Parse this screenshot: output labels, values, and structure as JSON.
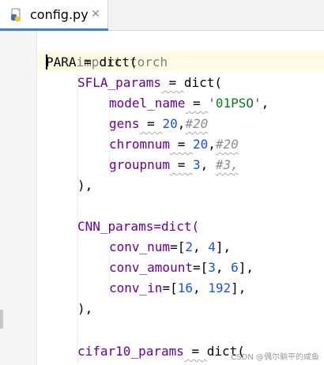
{
  "tab": {
    "filename": "config.py",
    "close_glyph": "✕",
    "icon": "python-file-icon"
  },
  "code": {
    "l1": {
      "text": "import torch"
    },
    "l2": {
      "name": "PARA",
      "op": " = ",
      "call": "dict("
    },
    "l3": {
      "name": "SFLA_params",
      "op": " = ",
      "call": "dict("
    },
    "l4": {
      "key": "model_name",
      "op": " = ",
      "value": "'01PSO'",
      "tail": ","
    },
    "l5": {
      "key": "gens",
      "op": " = ",
      "value": "20",
      "sep": ",",
      "comment": "#20"
    },
    "l6": {
      "key": "chromnum",
      "op": " = ",
      "value": "20",
      "sep": ",",
      "comment": "#20"
    },
    "l7": {
      "key": "groupnum",
      "op": " = ",
      "value": "3",
      "sep": ", ",
      "comment": "#3,"
    },
    "l8": {
      "text": "),"
    },
    "l9": {
      "text": "CNN_params=dict("
    },
    "l10": {
      "key": "conv_num",
      "pre": "=[",
      "v1": "2",
      "sep": ", ",
      "v2": "4",
      "post": "],"
    },
    "l11": {
      "key": "conv_amount",
      "pre": "=[",
      "v1": "3",
      "sep": ", ",
      "v2": "6",
      "post": "],"
    },
    "l12": {
      "key": "conv_in",
      "pre": "=[",
      "v1": "16",
      "sep": ", ",
      "v2": "192",
      "post": "],"
    },
    "l13": {
      "text": "),"
    },
    "l14": {
      "name": "cifar10_params",
      "op": " = ",
      "call": "dict("
    }
  },
  "watermark": "CSDN @偶尔躺平的咸鱼",
  "colors": {
    "string": "#067d17",
    "number": "#1750eb",
    "comment": "#8c8c8c",
    "current_line": "#fffae3",
    "tab_underline": "#4083c9"
  }
}
